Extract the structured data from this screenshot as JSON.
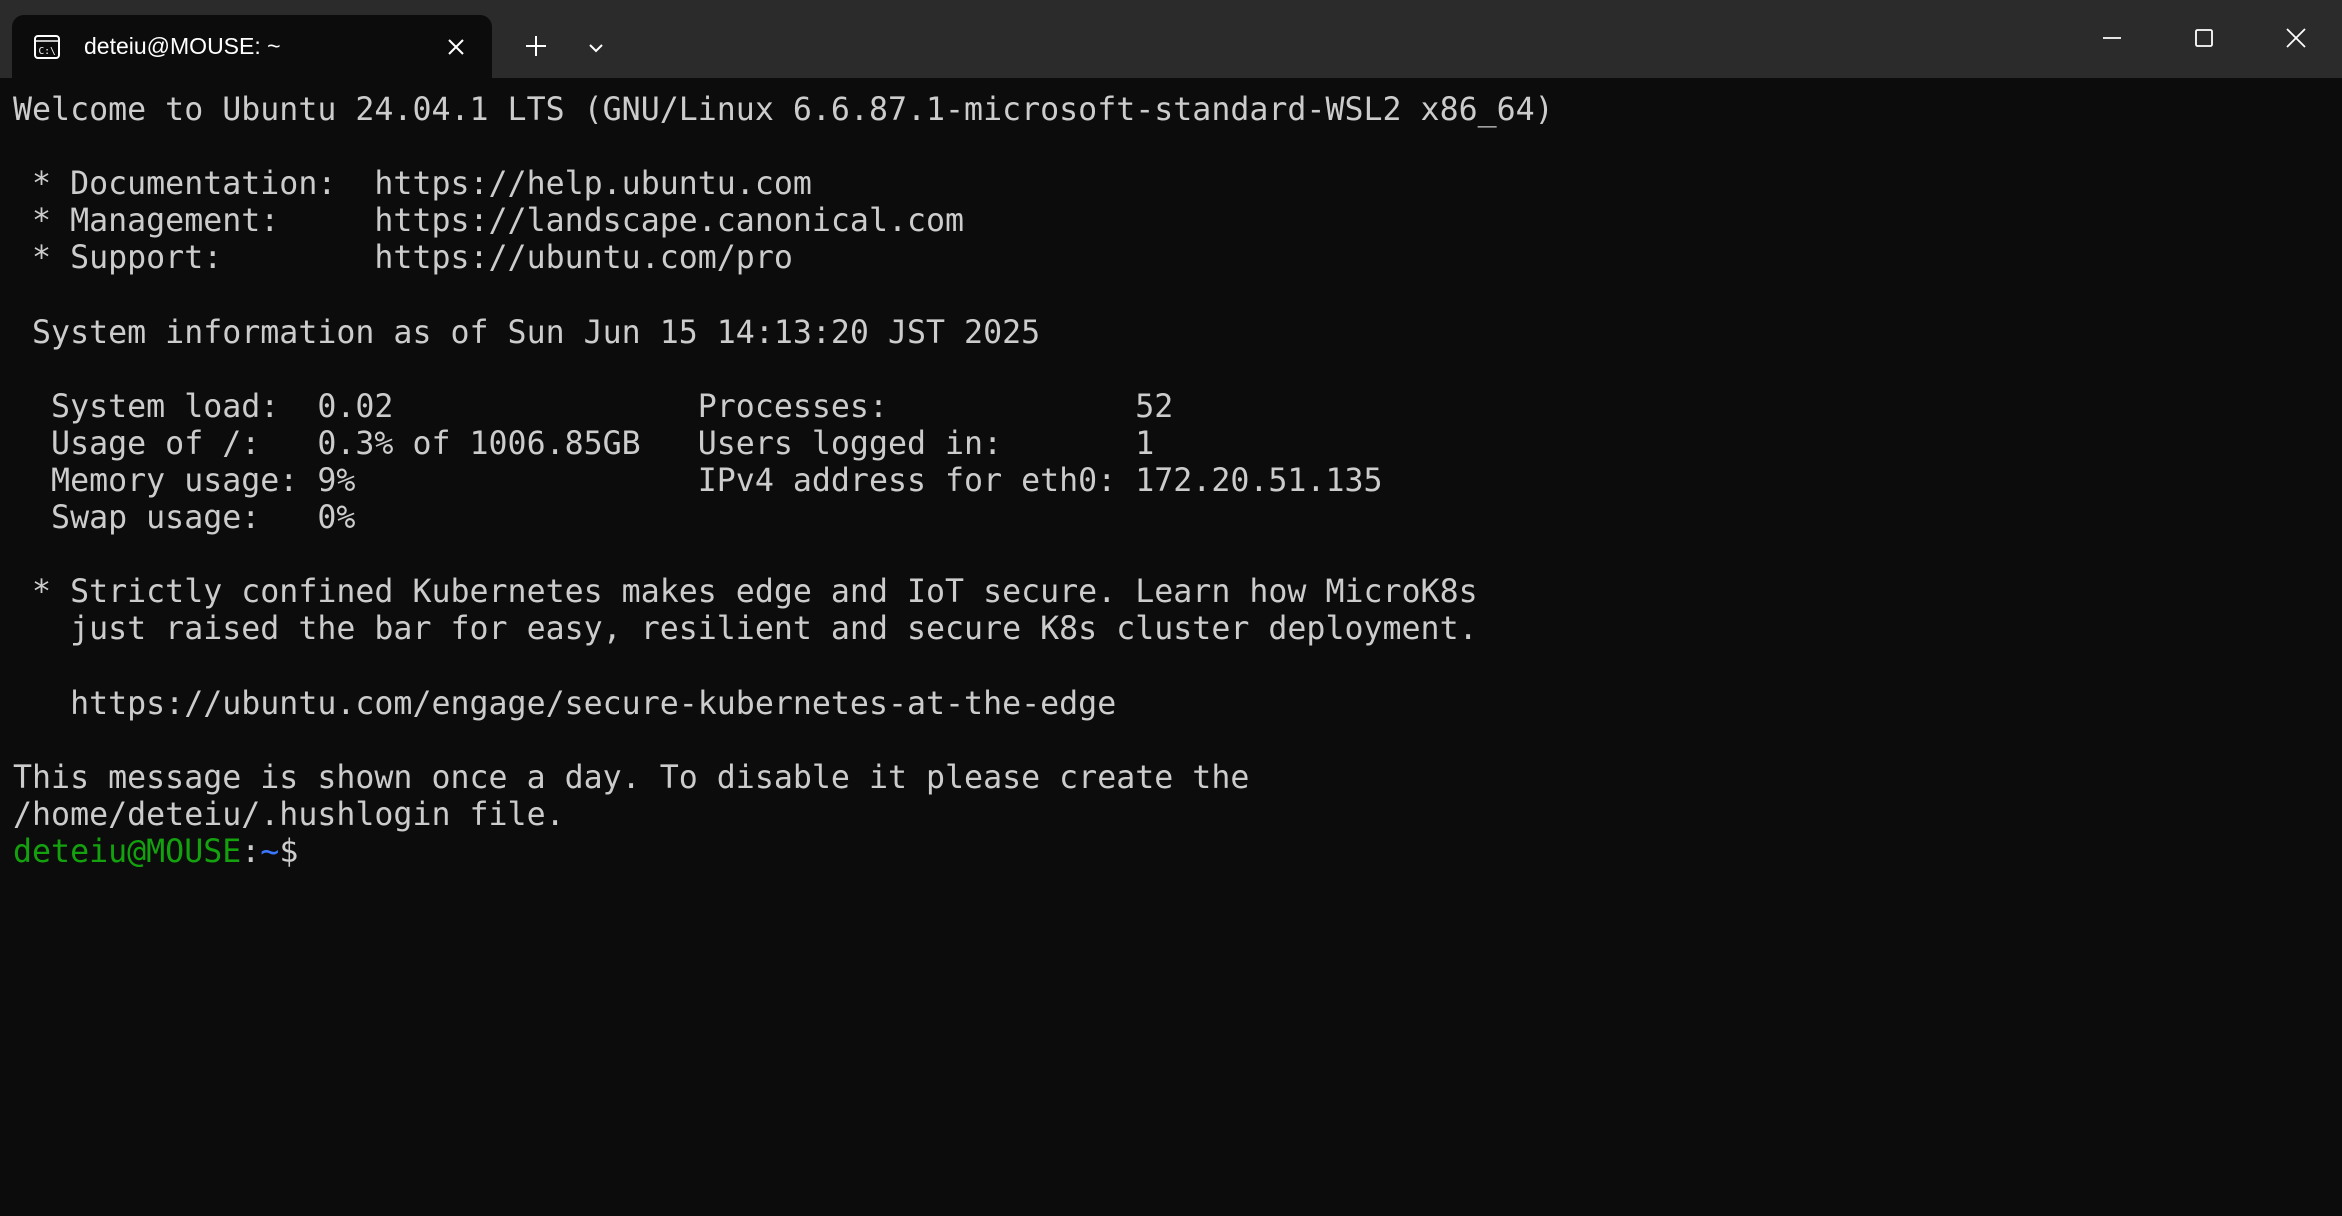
{
  "tab": {
    "title": "deteiu@MOUSE: ~",
    "icon": "terminal-icon"
  },
  "titlebar": {
    "new_tab_icon": "plus-icon",
    "dropdown_icon": "chevron-down-icon",
    "minimize_icon": "minimize-icon",
    "maximize_icon": "maximize-icon",
    "close_icon": "close-icon"
  },
  "terminal": {
    "welcome": "Welcome to Ubuntu 24.04.1 LTS (GNU/Linux 6.6.87.1-microsoft-standard-WSL2 x86_64)",
    "blank1": "",
    "doc": " * Documentation:  https://help.ubuntu.com",
    "mgmt": " * Management:     https://landscape.canonical.com",
    "support": " * Support:        https://ubuntu.com/pro",
    "blank2": "",
    "sysinfo": " System information as of Sun Jun 15 14:13:20 JST 2025",
    "blank3": "",
    "load": "  System load:  0.02                Processes:             52",
    "usage": "  Usage of /:   0.3% of 1006.85GB   Users logged in:       1",
    "memory": "  Memory usage: 9%                  IPv4 address for eth0: 172.20.51.135",
    "swap": "  Swap usage:   0%",
    "blank4": "",
    "k8s1": " * Strictly confined Kubernetes makes edge and IoT secure. Learn how MicroK8s",
    "k8s2": "   just raised the bar for easy, resilient and secure K8s cluster deployment.",
    "blank5": "",
    "k8s_url": "   https://ubuntu.com/engage/secure-kubernetes-at-the-edge",
    "blank6": "",
    "msg1": "This message is shown once a day. To disable it please create the",
    "msg2": "/home/deteiu/.hushlogin file.",
    "prompt": {
      "user": "deteiu@MOUSE",
      "sep": ":",
      "path": "~",
      "symbol": "$"
    }
  },
  "colors": {
    "background": "#0c0c0c",
    "titlebar": "#2b2b2b",
    "text": "#cccccc",
    "prompt_user": "#13a10e",
    "prompt_path": "#3b78ff"
  }
}
